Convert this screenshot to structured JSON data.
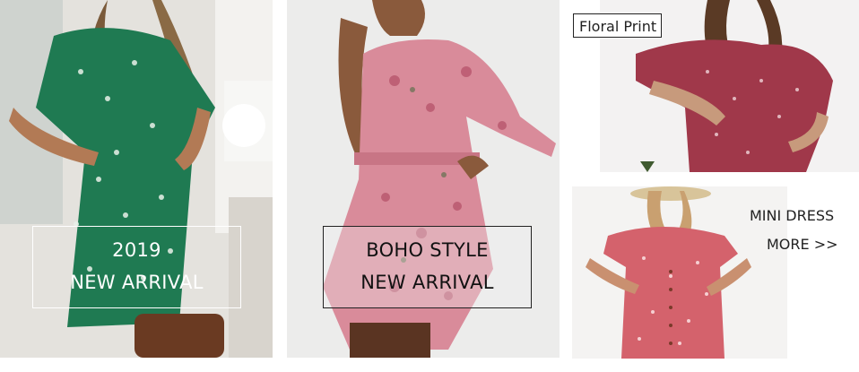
{
  "banners": [
    {
      "name": "green-floral-dress-banner",
      "caption_line1": "2019",
      "caption_line2": "NEW  ARRIVAL",
      "text_color": "#ffffff"
    },
    {
      "name": "boho-style-banner",
      "caption_line1": "BOHO STYLE",
      "caption_line2": "NEW  ARRIVAL",
      "text_color": "#111111"
    },
    {
      "name": "floral-print-banner",
      "label": "Floral Print",
      "text_color": "#222222"
    },
    {
      "name": "mini-dress-banner",
      "label_line1": "MINI DRESS",
      "label_line2": "MORE >>",
      "text_color": "#222222"
    }
  ],
  "colors": {
    "green_dress": "#1f7a52",
    "pink_dress": "#d98b9a",
    "red_dress": "#a0384a",
    "coral_dress": "#d4626c"
  }
}
